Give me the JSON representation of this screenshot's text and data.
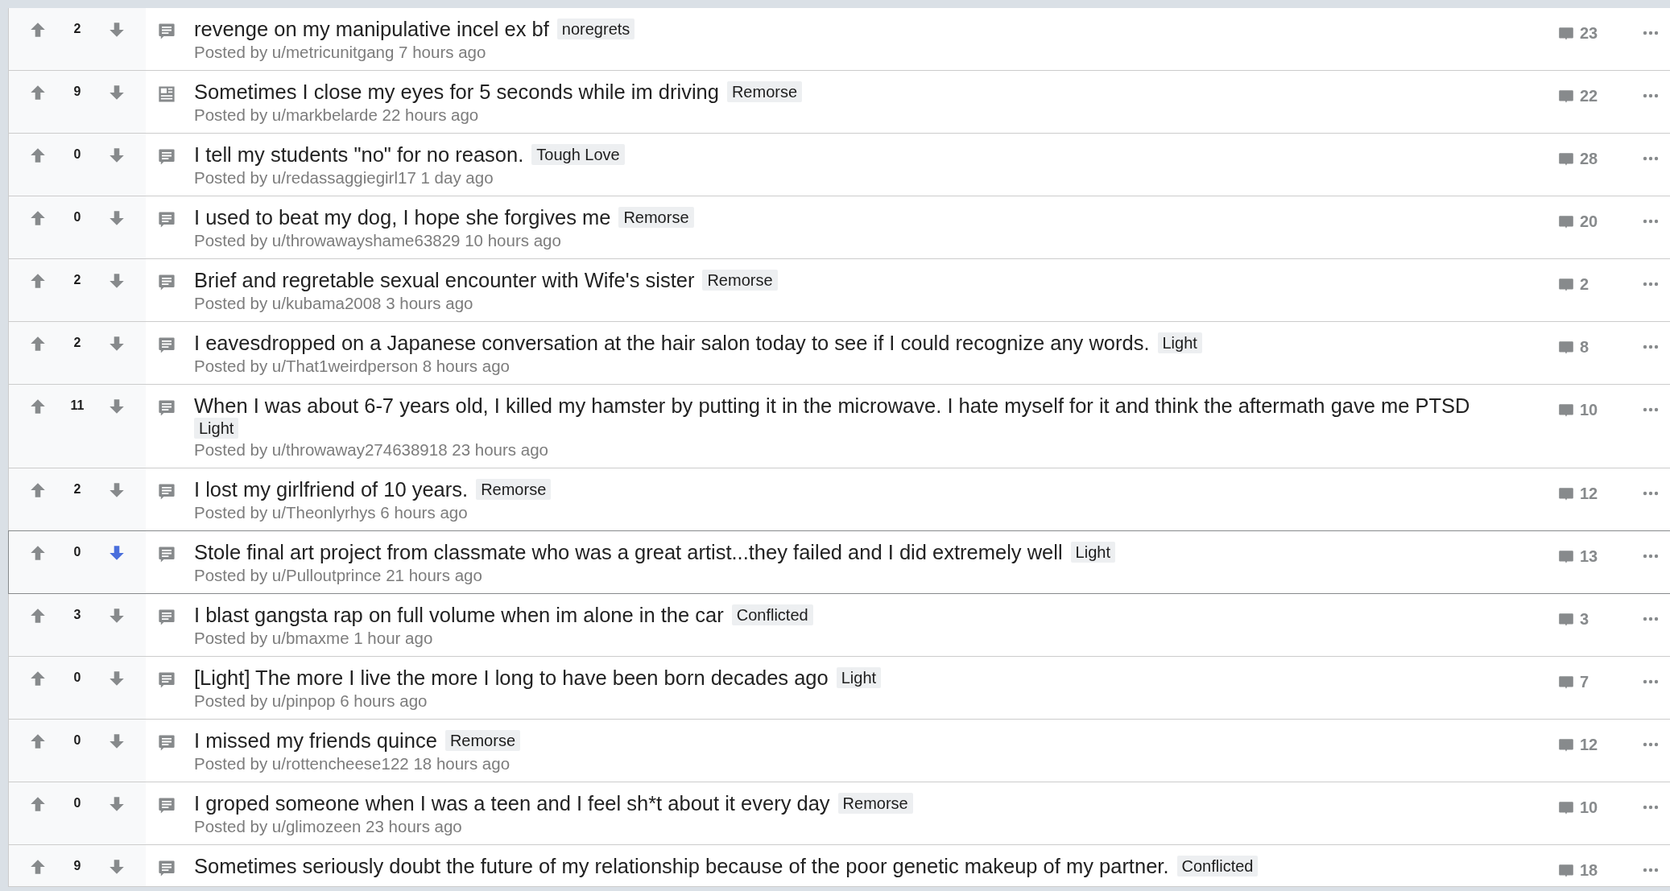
{
  "posts": [
    {
      "score": "2",
      "upvoted": false,
      "downvoted": false,
      "kind": "text",
      "title": "revenge on my manipulative incel ex bf",
      "flair": "noregrets",
      "meta": "Posted by u/metricunitgang 7 hours ago",
      "comments": "23",
      "highlighted": false
    },
    {
      "score": "9",
      "upvoted": false,
      "downvoted": false,
      "kind": "link",
      "title": "Sometimes I close my eyes for 5 seconds while im driving",
      "flair": "Remorse",
      "meta": "Posted by u/markbelarde 22 hours ago",
      "comments": "22",
      "highlighted": false
    },
    {
      "score": "0",
      "upvoted": false,
      "downvoted": false,
      "kind": "text",
      "title": "I tell my students \"no\" for no reason.",
      "flair": "Tough Love",
      "meta": "Posted by u/redassaggiegirl17 1 day ago",
      "comments": "28",
      "highlighted": false
    },
    {
      "score": "0",
      "upvoted": false,
      "downvoted": false,
      "kind": "text",
      "title": "I used to beat my dog, I hope she forgives me",
      "flair": "Remorse",
      "meta": "Posted by u/throwawayshame63829 10 hours ago",
      "comments": "20",
      "highlighted": false
    },
    {
      "score": "2",
      "upvoted": false,
      "downvoted": false,
      "kind": "text",
      "title": "Brief and regretable sexual encounter with Wife's sister",
      "flair": "Remorse",
      "meta": "Posted by u/kubama2008 3 hours ago",
      "comments": "2",
      "highlighted": false
    },
    {
      "score": "2",
      "upvoted": false,
      "downvoted": false,
      "kind": "text",
      "title": "I eavesdropped on a Japanese conversation at the hair salon today to see if I could recognize any words.",
      "flair": "Light",
      "meta": "Posted by u/That1weirdperson 8 hours ago",
      "comments": "8",
      "highlighted": false
    },
    {
      "score": "11",
      "upvoted": false,
      "downvoted": false,
      "kind": "text",
      "title": "When I was about 6-7 years old, I killed my hamster by putting it in the microwave. I hate myself for it and think the aftermath gave me PTSD",
      "flair": "Light",
      "meta": "Posted by u/throwaway274638918 23 hours ago",
      "comments": "10",
      "highlighted": false
    },
    {
      "score": "2",
      "upvoted": false,
      "downvoted": false,
      "kind": "text",
      "title": "I lost my girlfriend of 10 years.",
      "flair": "Remorse",
      "meta": "Posted by u/Theonlyrhys 6 hours ago",
      "comments": "12",
      "highlighted": false
    },
    {
      "score": "0",
      "upvoted": false,
      "downvoted": true,
      "kind": "text",
      "title": "Stole final art project from classmate who was a great artist...they failed and I did extremely well",
      "flair": "Light",
      "meta": "Posted by u/Pulloutprince 21 hours ago",
      "comments": "13",
      "highlighted": true
    },
    {
      "score": "3",
      "upvoted": false,
      "downvoted": false,
      "kind": "text",
      "title": "I blast gangsta rap on full volume when im alone in the car",
      "flair": "Conflicted",
      "meta": "Posted by u/bmaxme 1 hour ago",
      "comments": "3",
      "highlighted": false
    },
    {
      "score": "0",
      "upvoted": false,
      "downvoted": false,
      "kind": "text",
      "title": "[Light] The more I live the more I long to have been born decades ago",
      "flair": "Light",
      "meta": "Posted by u/pinpop 6 hours ago",
      "comments": "7",
      "highlighted": false
    },
    {
      "score": "0",
      "upvoted": false,
      "downvoted": false,
      "kind": "text",
      "title": "I missed my friends quince",
      "flair": "Remorse",
      "meta": "Posted by u/rottencheese122 18 hours ago",
      "comments": "12",
      "highlighted": false
    },
    {
      "score": "0",
      "upvoted": false,
      "downvoted": false,
      "kind": "text",
      "title": "I groped someone when I was a teen and I feel sh*t about it every day",
      "flair": "Remorse",
      "meta": "Posted by u/glimozeen 23 hours ago",
      "comments": "10",
      "highlighted": false
    },
    {
      "score": "9",
      "upvoted": false,
      "downvoted": false,
      "kind": "text",
      "title": "Sometimes seriously doubt the future of my relationship because of the poor genetic makeup of my partner.",
      "flair": "Conflicted",
      "comments": "18",
      "highlighted": false
    }
  ]
}
